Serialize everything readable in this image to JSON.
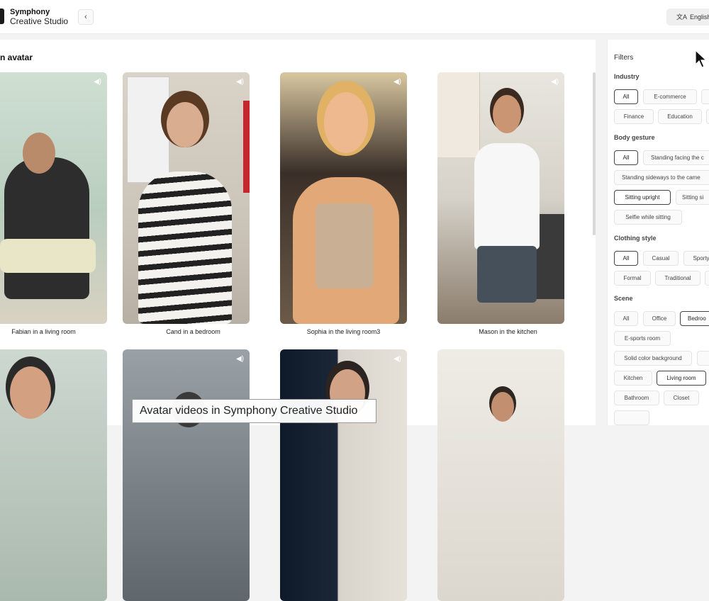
{
  "header": {
    "brand_line1": "Symphony",
    "brand_line2": "Creative Studio",
    "collapse_glyph": "‹",
    "language": "English",
    "language_icon": "translate-icon"
  },
  "main": {
    "heading": "n avatar",
    "avatars": [
      {
        "caption": "Fabian in a living room"
      },
      {
        "caption": "Cand in a bedroom"
      },
      {
        "caption": "Sophia in the living room3"
      },
      {
        "caption": "Mason in the kitchen"
      },
      {
        "caption": ""
      },
      {
        "caption": ""
      },
      {
        "caption": ""
      },
      {
        "caption": ""
      }
    ],
    "sound_icon": "speaker-icon"
  },
  "filters": {
    "title": "Filters",
    "groups": [
      {
        "label": "Industry",
        "chips": [
          {
            "label": "All",
            "selected": true
          },
          {
            "label": "E-commerce",
            "selected": false
          },
          {
            "label": "",
            "selected": false
          },
          {
            "label": "Finance",
            "selected": false
          },
          {
            "label": "Education",
            "selected": false
          },
          {
            "label": "",
            "selected": false
          }
        ]
      },
      {
        "label": "Body gesture",
        "chips": [
          {
            "label": "All",
            "selected": true
          },
          {
            "label": "Standing facing the c",
            "selected": false
          },
          {
            "label": "Standing sideways to the came",
            "selected": false
          },
          {
            "label": "Sitting upright",
            "selected": true
          },
          {
            "label": "Sitting si",
            "selected": false
          },
          {
            "label": "Selfie while sitting",
            "selected": false
          }
        ]
      },
      {
        "label": "Clothing style",
        "chips": [
          {
            "label": "All",
            "selected": true
          },
          {
            "label": "Casual",
            "selected": false
          },
          {
            "label": "Sporty",
            "selected": false
          },
          {
            "label": "Formal",
            "selected": false
          },
          {
            "label": "Traditional",
            "selected": false
          },
          {
            "label": "",
            "selected": false
          }
        ]
      },
      {
        "label": "Scene",
        "chips": [
          {
            "label": "All",
            "selected": false
          },
          {
            "label": "Office",
            "selected": false
          },
          {
            "label": "Bedroo",
            "selected": true
          },
          {
            "label": "E-sports room",
            "selected": false
          },
          {
            "label": "Solid color background",
            "selected": false
          },
          {
            "label": "",
            "selected": false
          },
          {
            "label": "Kitchen",
            "selected": false
          },
          {
            "label": "Living room",
            "selected": true
          },
          {
            "label": "Bathroom",
            "selected": false
          },
          {
            "label": "Closet",
            "selected": false
          },
          {
            "label": "",
            "selected": false
          }
        ]
      }
    ]
  },
  "overlay": {
    "subtitle": "Avatar videos in Symphony Creative Studio"
  }
}
